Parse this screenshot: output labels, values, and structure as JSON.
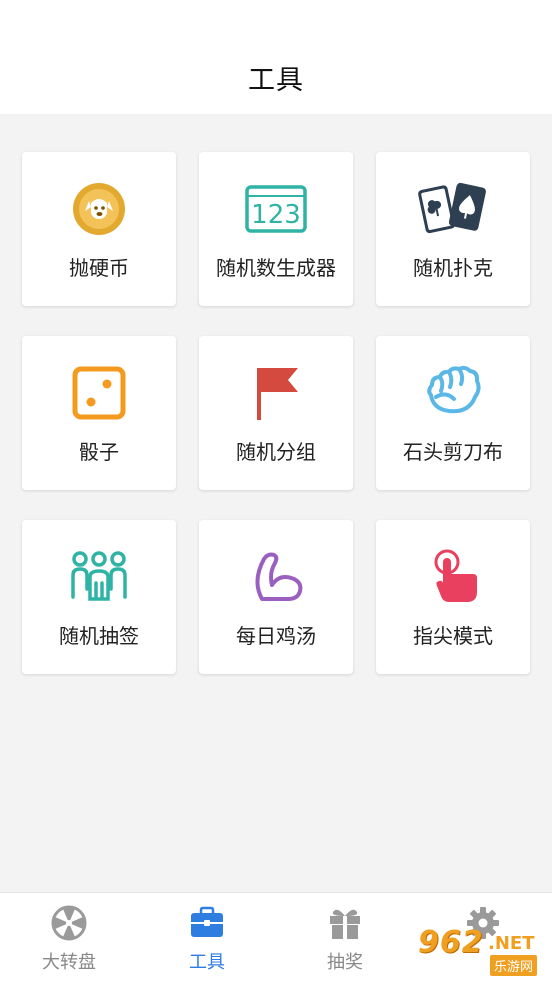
{
  "header": {
    "title": "工具"
  },
  "tools": [
    {
      "label": "抛硬币",
      "icon": "coin-dog-icon",
      "color": "#e3a92e"
    },
    {
      "label": "随机数生成器",
      "icon": "number-123-icon",
      "color": "#2fb3a5"
    },
    {
      "label": "随机扑克",
      "icon": "poker-cards-icon",
      "color": "#2e3f52"
    },
    {
      "label": "骰子",
      "icon": "dice-icon",
      "color": "#f39a1f"
    },
    {
      "label": "随机分组",
      "icon": "flag-icon",
      "color": "#d44a3f"
    },
    {
      "label": "石头剪刀布",
      "icon": "fist-icon",
      "color": "#5bb8e6"
    },
    {
      "label": "随机抽签",
      "icon": "people-group-icon",
      "color": "#2fb3a5"
    },
    {
      "label": "每日鸡汤",
      "icon": "muscle-arm-icon",
      "color": "#9b5fc0"
    },
    {
      "label": "指尖模式",
      "icon": "finger-tap-icon",
      "color": "#e8405e"
    }
  ],
  "tabbar": {
    "items": [
      {
        "label": "大转盘",
        "icon": "wheel-icon",
        "active": false
      },
      {
        "label": "工具",
        "icon": "toolbox-icon",
        "active": true
      },
      {
        "label": "抽奖",
        "icon": "gift-icon",
        "active": false
      },
      {
        "label": "",
        "icon": "gear-icon",
        "active": false
      }
    ],
    "active_color": "#2e7de1",
    "inactive_color": "#888888"
  },
  "watermark": {
    "number": "962",
    "suffix": ".NET",
    "site": "乐游网"
  }
}
